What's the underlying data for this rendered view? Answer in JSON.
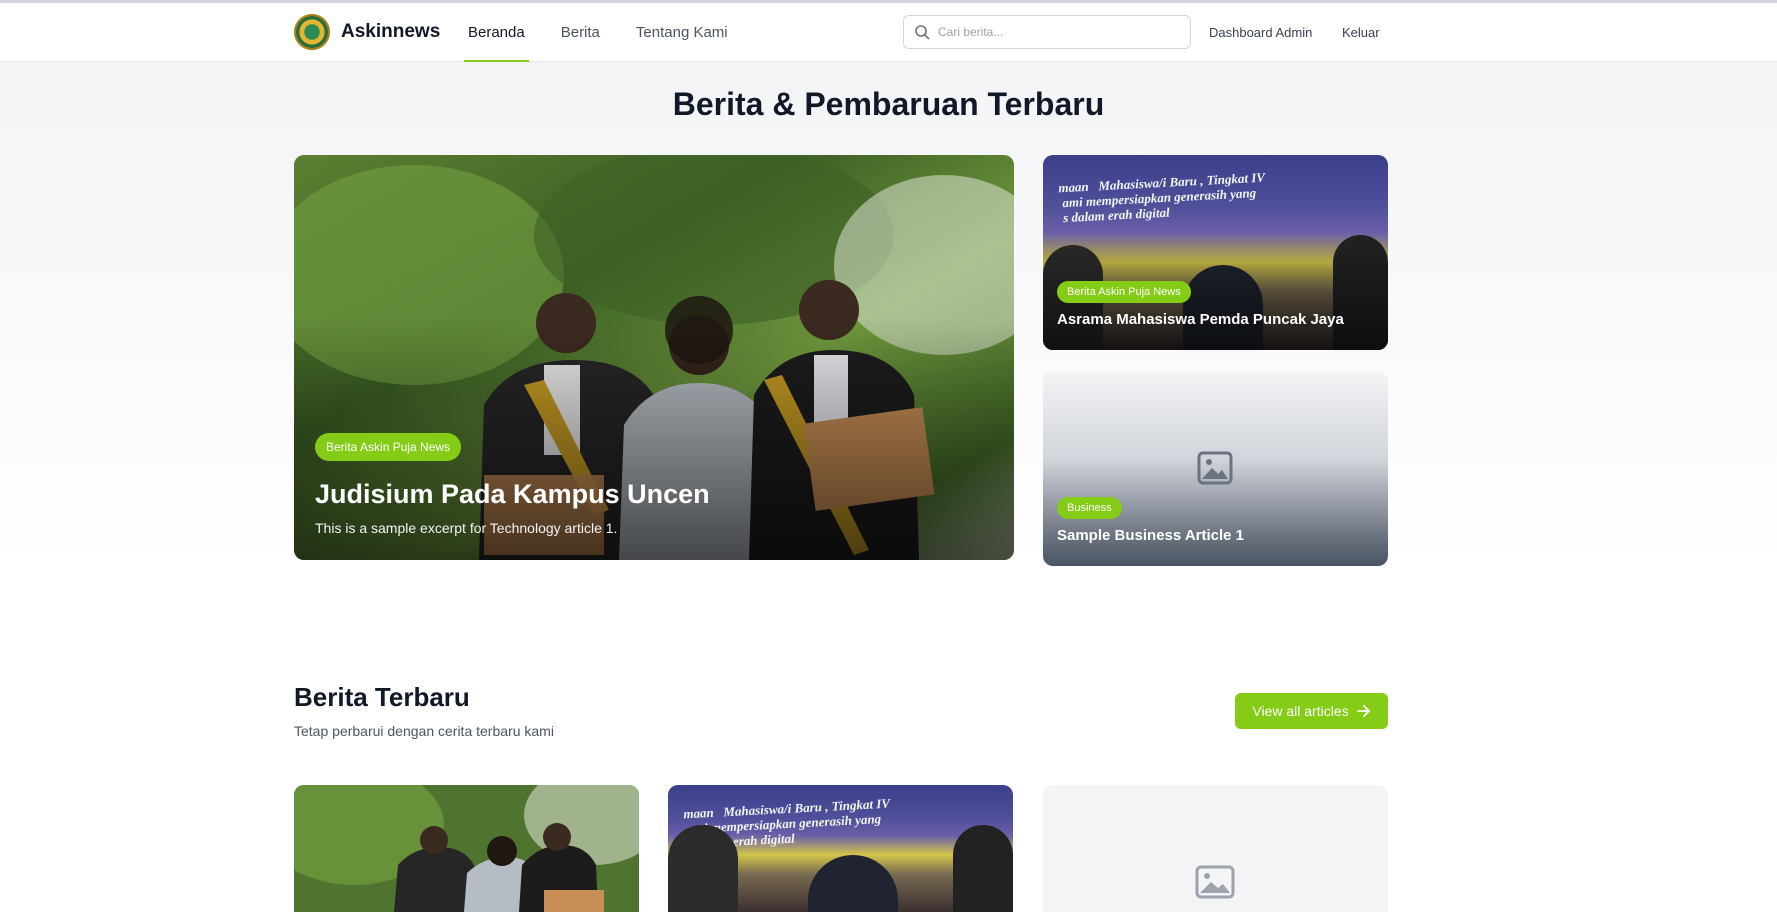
{
  "header": {
    "brand": "Askinnews",
    "nav": [
      {
        "label": "Beranda",
        "active": true
      },
      {
        "label": "Berita",
        "active": false
      },
      {
        "label": "Tentang Kami",
        "active": false
      }
    ],
    "search_placeholder": "Cari berita...",
    "dashboard_link": "Dashboard Admin",
    "logout_link": "Keluar"
  },
  "hero": {
    "title": "Berita & Pembaruan Terbaru",
    "main": {
      "badge": "Berita Askin Puja News",
      "title": "Judisium Pada Kampus Uncen",
      "excerpt": "This is a sample excerpt for Technology article 1."
    },
    "side": [
      {
        "badge": "Berita Askin Puja News",
        "title": "Asrama Mahasiswa Pemda Puncak Jaya"
      },
      {
        "badge": "Business",
        "title": "Sample Business Article 1"
      }
    ]
  },
  "latest": {
    "title": "Berita Terbaru",
    "subtitle": "Tetap perbarui dengan cerita terbaru kami",
    "button": "View all articles"
  },
  "colors": {
    "accent": "#84cc16",
    "text": "#111827",
    "muted": "#4b5563"
  }
}
